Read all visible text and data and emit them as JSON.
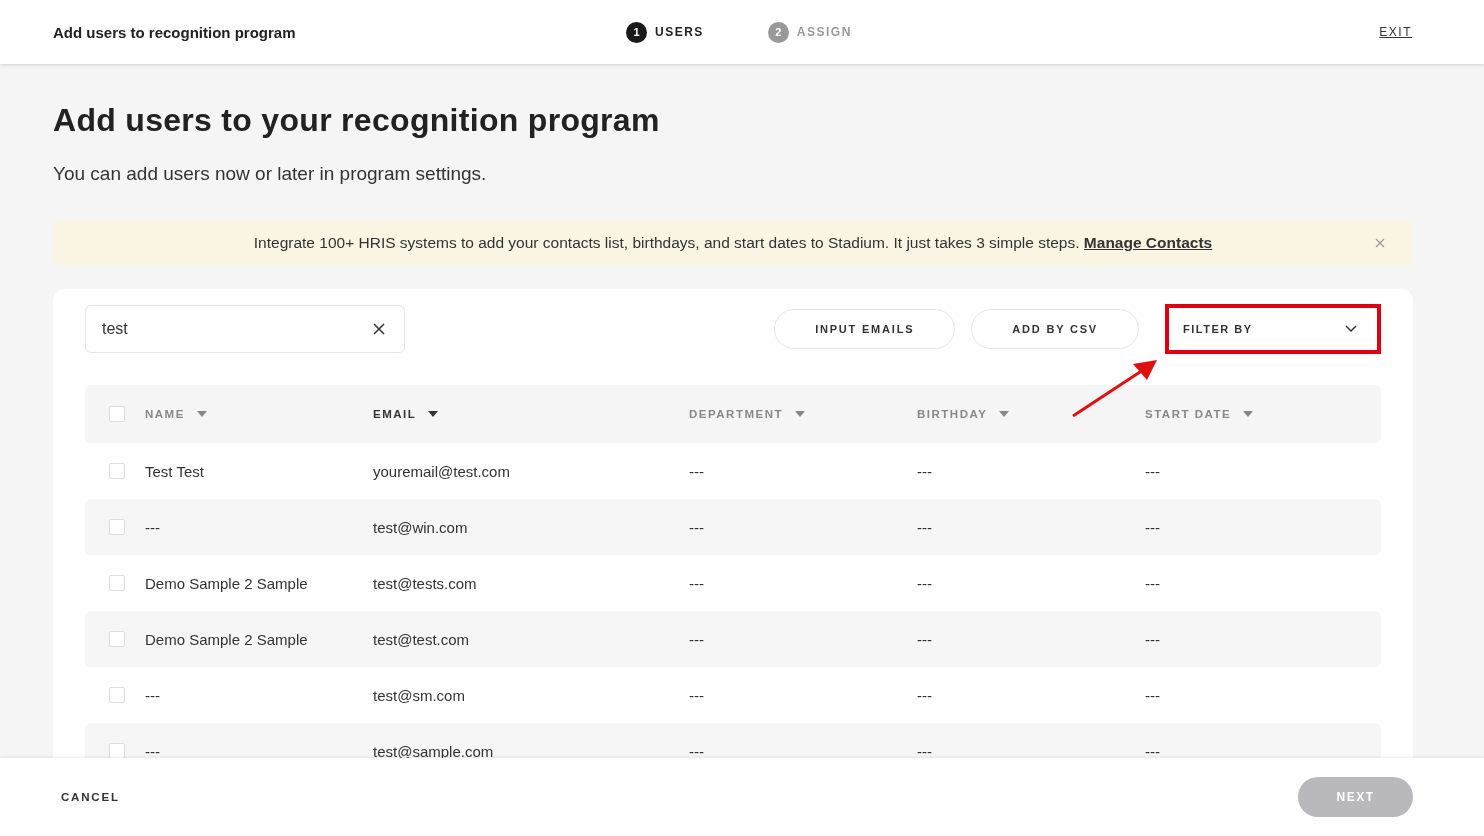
{
  "header": {
    "title": "Add users to recognition program",
    "steps": [
      {
        "number": "1",
        "label": "USERS",
        "selected": true
      },
      {
        "number": "2",
        "label": "ASSIGN",
        "selected": false
      }
    ],
    "exit": "EXIT"
  },
  "page": {
    "heading": "Add users to your recognition program",
    "subheading": "You can add users now or later in program settings."
  },
  "banner": {
    "text": "Integrate 100+ HRIS systems to add your contacts list, birthdays, and start dates to Stadium. It just takes 3 simple steps.",
    "link": "Manage Contacts"
  },
  "toolbar": {
    "search": {
      "value": "test"
    },
    "buttons": [
      "INPUT EMAILS",
      "ADD BY CSV"
    ],
    "filter": {
      "label": "FILTER BY",
      "highlighted": true
    }
  },
  "table": {
    "select_all": {
      "checked": false
    },
    "columns": [
      {
        "label": "NAME",
        "sorted": false
      },
      {
        "label": "EMAIL",
        "sorted": true
      },
      {
        "label": "DEPARTMENT",
        "sorted": false
      },
      {
        "label": "BIRTHDAY",
        "sorted": false
      },
      {
        "label": "START DATE",
        "sorted": false
      }
    ],
    "rows": [
      {
        "checked": false,
        "cells": [
          "Test Test",
          "youremail@test.com",
          "---",
          "---",
          "---"
        ]
      },
      {
        "checked": false,
        "cells": [
          "---",
          "test@win.com",
          "---",
          "---",
          "---"
        ]
      },
      {
        "checked": false,
        "cells": [
          "Demo Sample 2 Sample",
          "test@tests.com",
          "---",
          "---",
          "---"
        ]
      },
      {
        "checked": false,
        "cells": [
          "Demo Sample 2 Sample",
          "test@test.com",
          "---",
          "---",
          "---"
        ]
      },
      {
        "checked": false,
        "cells": [
          "---",
          "test@sm.com",
          "---",
          "---",
          "---"
        ]
      },
      {
        "checked": false,
        "cells": [
          "---",
          "test@sample.com",
          "---",
          "---",
          "---"
        ]
      }
    ]
  },
  "footer": {
    "cancel": "CANCEL",
    "next": {
      "label": "NEXT",
      "disabled": true
    }
  }
}
